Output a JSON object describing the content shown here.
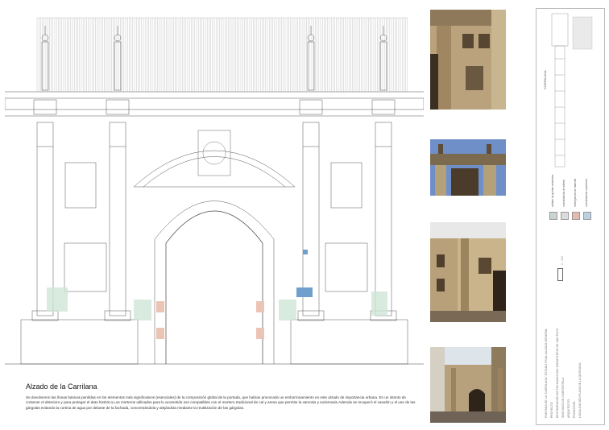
{
  "caption": {
    "title": "Alzado de la Carrilana",
    "body": "Se devolvieron las líneas básicas perdidas en los elementos más significativos (esenciales) de la composición global de la portada, que habían provocado un emborronamiento en este alzado de importancia urbana. En un intento de contener el deterioro y para proteger el dato histórico.Los morteros utilizados para lo acometido son compatibles con el mortero tradicional de cal y arena que permite la osmosis y exósmosis.Además se recuperó el canalón y el uso de las gárgolas evitando la cortina de agua por delante de la fachada, concentrándola y alejándola mediante la reutilización de las gárgolas."
  },
  "sheet": {
    "plan_label": "CARRILANA",
    "scale_label": "1 : 100",
    "title_lines": [
      "PORTADA DE LA \"CARRILANA\"   ESTADO FINAL:ALZADO GENERAL",
      "PROYECTO",
      "RESTAURACIÓN DE FACHADAS DEL MONASTERIO DE SAN PAYO",
      "SANTIAGO DE COMPOSTELA",
      "ARQUITECTO",
      "PROMOTOR",
      "LOCALIZACIÓN:PLAZA DE LA QUINTANA"
    ],
    "legend": [
      {
        "label": "sellado de grietas existentes",
        "color": "#c9d4d0"
      },
      {
        "label": "consolidación de sillería",
        "color": "#dcdcdc"
      },
      {
        "label": "reintegración de material",
        "color": "#e6b9ad"
      },
      {
        "label": "consolidación superficial",
        "color": "#bcd0e2"
      }
    ]
  },
  "colors": {
    "line": "#4a4a4a",
    "green_zone": "#cfe6d7",
    "red_zone": "#ecc4b6",
    "blue_zone": "#6f9fcc"
  }
}
